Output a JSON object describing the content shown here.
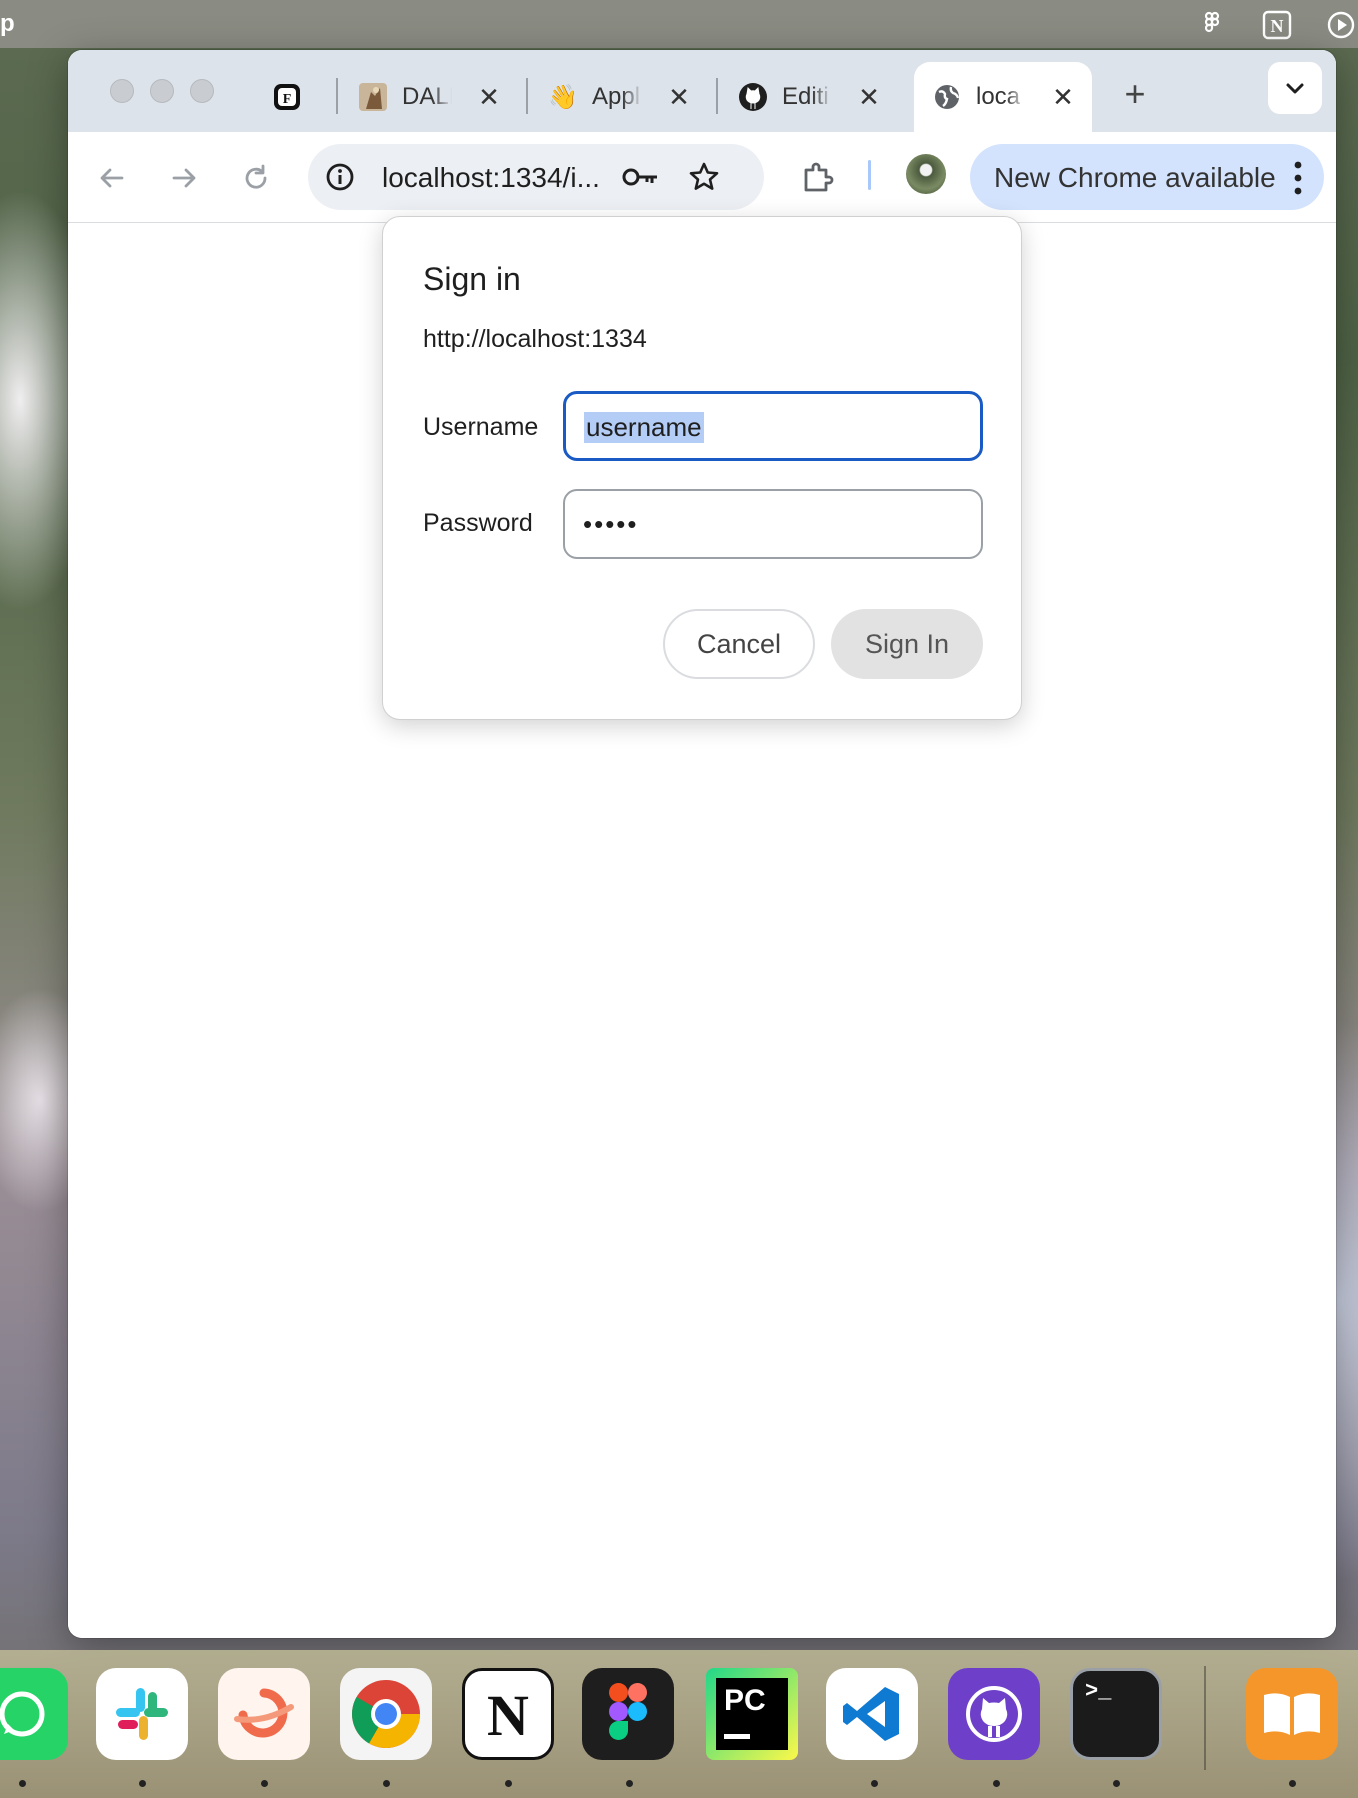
{
  "menubar": {
    "app_name_fragment": "p",
    "status_icons": [
      "figma-icon",
      "notion-icon",
      "play-circle-icon"
    ]
  },
  "tabs": [
    {
      "title": "",
      "favicon": "framer-F-icon",
      "closable": false
    },
    {
      "title": "DALL",
      "favicon": "dalle-image-icon",
      "closable": true
    },
    {
      "title": "Appl",
      "favicon": "waving-hand-emoji",
      "closable": true
    },
    {
      "title": "Editi",
      "favicon": "github-icon",
      "closable": true
    },
    {
      "title": "loca",
      "favicon": "globe-icon",
      "closable": true,
      "active": true
    }
  ],
  "toolbar": {
    "address": "localhost:1334/i...",
    "update_label": "New Chrome available"
  },
  "dialog": {
    "title": "Sign in",
    "origin": "http://localhost:1334",
    "username_label": "Username",
    "username_value": "username",
    "password_label": "Password",
    "password_value": "•••••",
    "cancel_label": "Cancel",
    "signin_label": "Sign In"
  },
  "dock": {
    "apps": [
      "WhatsApp",
      "Slack",
      "Arc",
      "Google Chrome",
      "Notion",
      "Figma",
      "PyCharm",
      "Visual Studio Code",
      "GitHub Desktop",
      "Terminal",
      "Books"
    ]
  },
  "colors": {
    "focus_ring": "#1a5ac4",
    "selection": "#b4cdf7",
    "update_chip": "#d3e3fd",
    "tabstrip": "#dde3ea"
  }
}
